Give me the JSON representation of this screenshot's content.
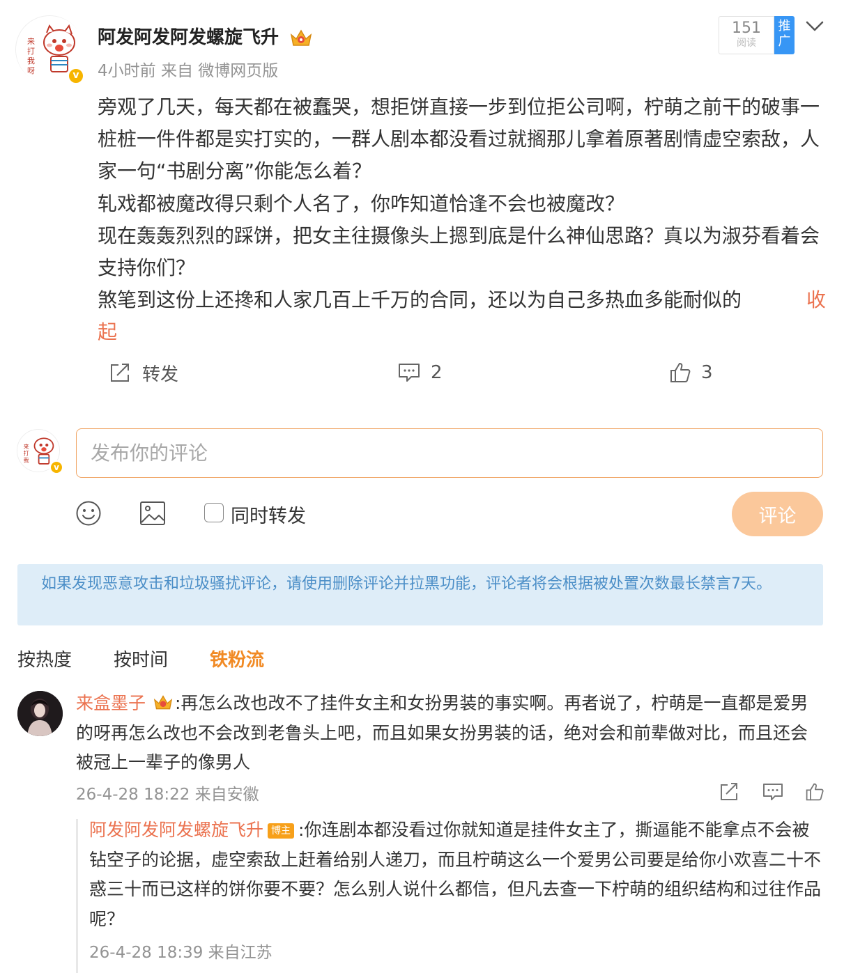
{
  "post": {
    "author": "阿发阿发阿发螺旋飞升",
    "time_source": "4小时前 来自 微博网页版",
    "read_count": "151",
    "read_label": "阅读",
    "promote_label": "推广",
    "paragraphs": [
      "旁观了几天，每天都在被蠢哭，想拒饼直接一步到位拒公司啊，柠萌之前干的破事一桩桩一件件都是实打实的，一群人剧本都没看过就搁那儿拿着原著剧情虚空索敌，人家一句“书剧分离”你能怎么着？",
      "轧戏都被魔改得只剩个人名了，你咋知道恰逢不会也被魔改？",
      "现在轰轰烈烈的踩饼，把女主往摄像头上摁到底是什么神仙思路？真以为淑芬看着会支持你们？",
      "煞笔到这份上还搀和人家几百上千万的合同，还以为自己多热血多能耐似的"
    ],
    "collapse_label_1": "收",
    "collapse_label_2": "起",
    "actions": {
      "repost_label": "转发",
      "comment_count": "2",
      "like_count": "3"
    }
  },
  "composer": {
    "placeholder": "发布你的评论",
    "repost_also_label": "同时转发",
    "submit_label": "评论"
  },
  "notice": "如果发现恶意攻击和垃圾骚扰评论，请使用删除评论并拉黑功能，评论者将会根据被处置次数最长禁言7天。",
  "sort_tabs": [
    {
      "label": "按热度",
      "active": false
    },
    {
      "label": "按时间",
      "active": false
    },
    {
      "label": "铁粉流",
      "active": true
    }
  ],
  "comment": {
    "user": "来盒墨子",
    "text": ":再怎么改也改不了挂件女主和女扮男装的事实啊。再者说了，柠萌是一直都是爱男的呀再怎么改也不会改到老鲁头上吧，而且如果女扮男装的话，绝对会和前辈做对比，而且还会被冠上一辈子的像男人",
    "meta": "26-4-28 18:22 来自安徽"
  },
  "reply": {
    "user": "阿发阿发阿发螺旋飞升",
    "badge": "博主",
    "text": ":你连剧本都没看过你就知道是挂件女主了，撕逼能不能拿点不会被钻空子的论据，虚空索敌上赶着给别人递刀，而且柠萌这么一个爱男公司要是给你小欢喜二十不惑三十而已这样的饼你要不要？怎么别人说什么都信，但凡去查一下柠萌的组织结构和过往作品呢？",
    "meta": "26-4-28 18:39 来自江苏"
  },
  "colors": {
    "accent_orange": "#eb7350",
    "active_tab": "#f18a24",
    "verified_badge": "#f7b500",
    "promote_blue": "#3796f5",
    "notice_bg": "#deedf8",
    "notice_text": "#4b8ec7",
    "submit_disabled": "#fbc89b"
  },
  "icons": [
    "chevron-down-icon",
    "crown-icon",
    "repost-icon",
    "comment-icon",
    "like-icon",
    "emoji-icon",
    "image-icon",
    "share-icon"
  ]
}
